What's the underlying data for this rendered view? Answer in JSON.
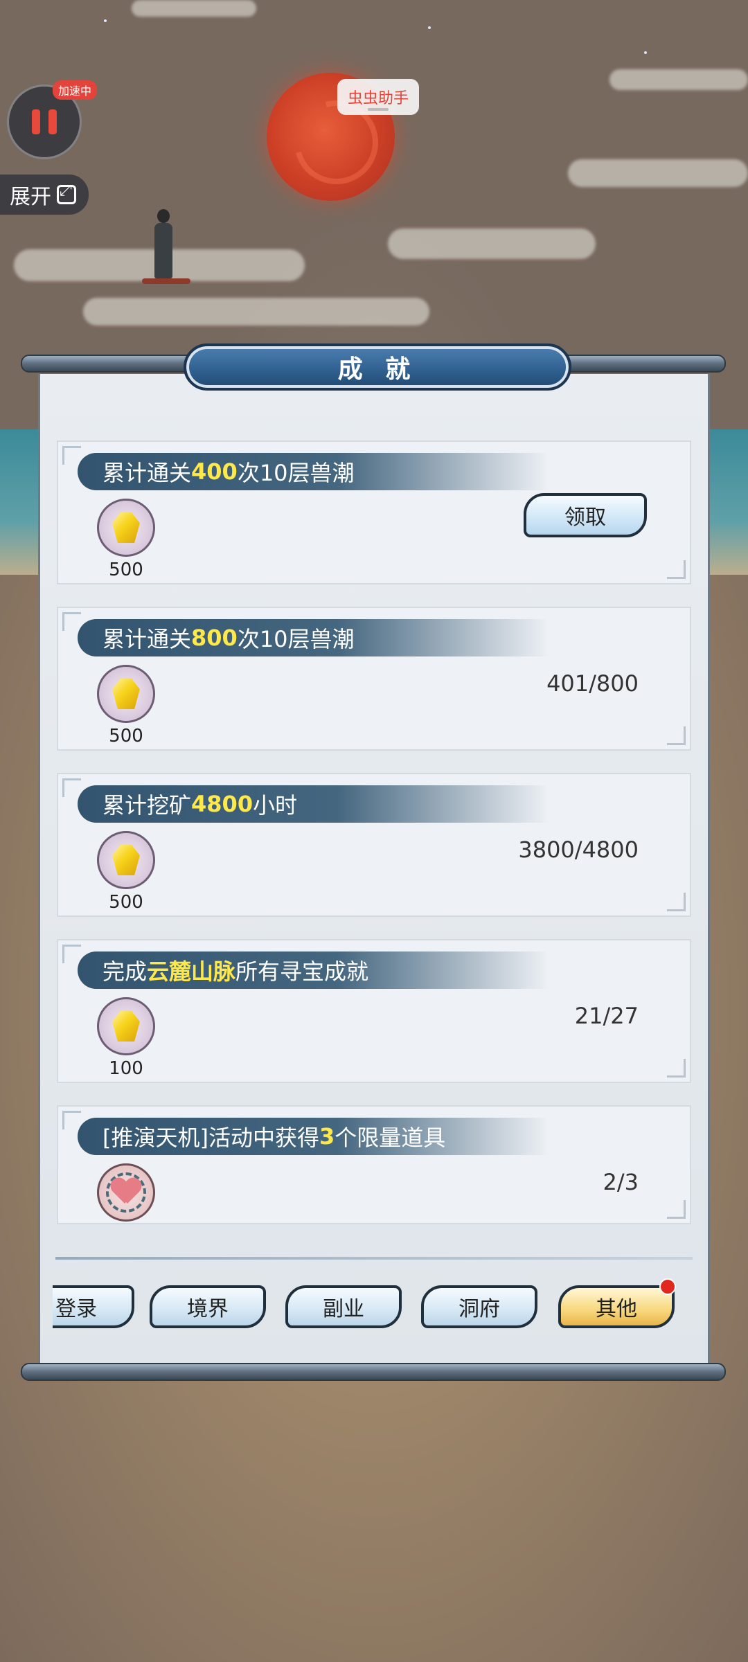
{
  "helper": {
    "speed_badge": "加速中",
    "expand_label": "展开",
    "assistant_label": "虫虫助手"
  },
  "panel": {
    "title": "成 就",
    "claim_label": "领取"
  },
  "achievements": [
    {
      "pre": "累计通关",
      "hl": "400",
      "post": "次10层兽潮",
      "reward_icon": "gold-gem-icon",
      "reward_amount": "500",
      "status": "claimable",
      "progress": ""
    },
    {
      "pre": "累计通关",
      "hl": "800",
      "post": "次10层兽潮",
      "reward_icon": "gold-gem-icon",
      "reward_amount": "500",
      "status": "in-progress",
      "progress": "401/800"
    },
    {
      "pre": "累计挖矿",
      "hl": "4800",
      "post": "小时",
      "reward_icon": "gold-gem-icon",
      "reward_amount": "500",
      "status": "in-progress",
      "progress": "3800/4800"
    },
    {
      "pre": "完成",
      "hl": "云麓山脉",
      "post": "所有寻宝成就",
      "reward_icon": "gold-gem-icon",
      "reward_amount": "100",
      "status": "in-progress",
      "progress": "21/27"
    },
    {
      "pre": "[推演天机]活动中获得",
      "hl": "3",
      "post": "个限量道具",
      "reward_icon": "heart-charm-icon",
      "reward_amount": "",
      "status": "in-progress",
      "progress": "2/3"
    }
  ],
  "tabs": [
    {
      "label": "登录",
      "active": false
    },
    {
      "label": "境界",
      "active": false
    },
    {
      "label": "副业",
      "active": false
    },
    {
      "label": "洞府",
      "active": false
    },
    {
      "label": "其他",
      "active": true
    }
  ],
  "colors": {
    "highlight": "#ffe94a",
    "banner": "#33546f",
    "badge": "#e0281e"
  }
}
